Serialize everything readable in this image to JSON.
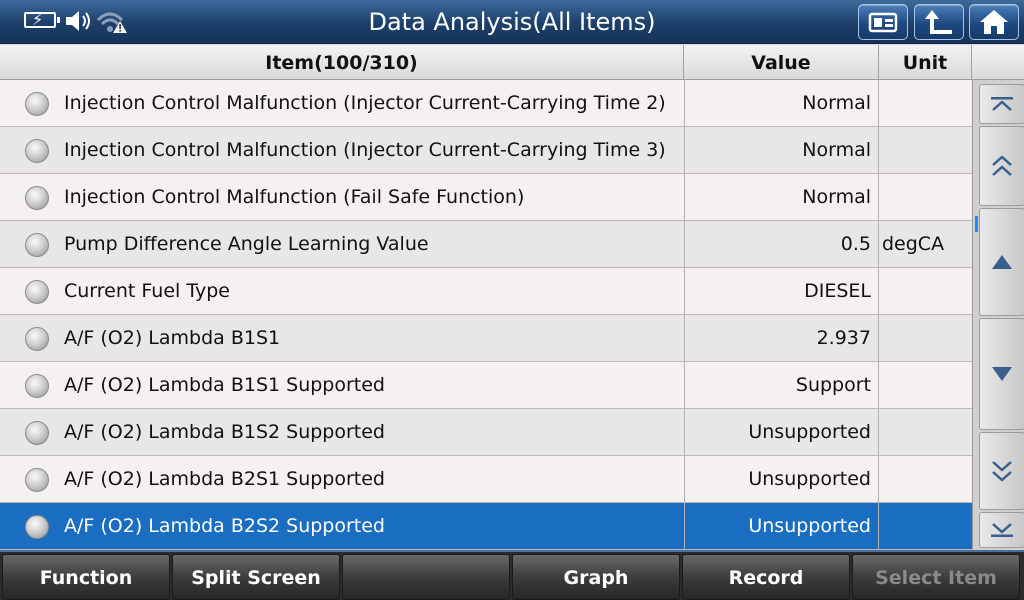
{
  "titlebar": {
    "title": "Data Analysis(All Items)",
    "status_icons": [
      "battery-charging-icon",
      "speaker-icon",
      "wifi-warning-icon"
    ],
    "buttons": [
      "screenshot-icon",
      "back-arrow-icon",
      "home-icon"
    ]
  },
  "table": {
    "headers": {
      "item": "Item(100/310)",
      "value": "Value",
      "unit": "Unit"
    },
    "rows": [
      {
        "item": "Injection Control Malfunction (Injector Current-Carrying Time 2)",
        "value": "Normal",
        "unit": ""
      },
      {
        "item": "Injection Control Malfunction (Injector Current-Carrying Time 3)",
        "value": "Normal",
        "unit": ""
      },
      {
        "item": "Injection Control Malfunction (Fail Safe Function)",
        "value": "Normal",
        "unit": ""
      },
      {
        "item": "Pump Difference Angle Learning Value",
        "value": "0.5",
        "unit": "degCA"
      },
      {
        "item": "Current Fuel Type",
        "value": "DIESEL",
        "unit": ""
      },
      {
        "item": "A/F (O2) Lambda B1S1",
        "value": "2.937",
        "unit": ""
      },
      {
        "item": "A/F (O2) Lambda B1S1 Supported",
        "value": "Support",
        "unit": ""
      },
      {
        "item": "A/F (O2) Lambda B1S2 Supported",
        "value": "Unsupported",
        "unit": ""
      },
      {
        "item": "A/F (O2) Lambda B2S1 Supported",
        "value": "Unsupported",
        "unit": ""
      },
      {
        "item": "A/F (O2) Lambda B2S2 Supported",
        "value": "Unsupported",
        "unit": ""
      }
    ],
    "selected_index": 9
  },
  "bottombar": {
    "buttons": [
      {
        "label": "Function",
        "enabled": true
      },
      {
        "label": "Split Screen",
        "enabled": true
      },
      {
        "label": "",
        "enabled": true
      },
      {
        "label": "Graph",
        "enabled": true
      },
      {
        "label": "Record",
        "enabled": true
      },
      {
        "label": "Select Item",
        "enabled": false
      }
    ]
  },
  "colors": {
    "title_bar": "#1d3f6a",
    "selected_row": "#1a6ec1",
    "bottom_bar": "#2c2c2c",
    "disabled_text": "#8a8a8a"
  }
}
